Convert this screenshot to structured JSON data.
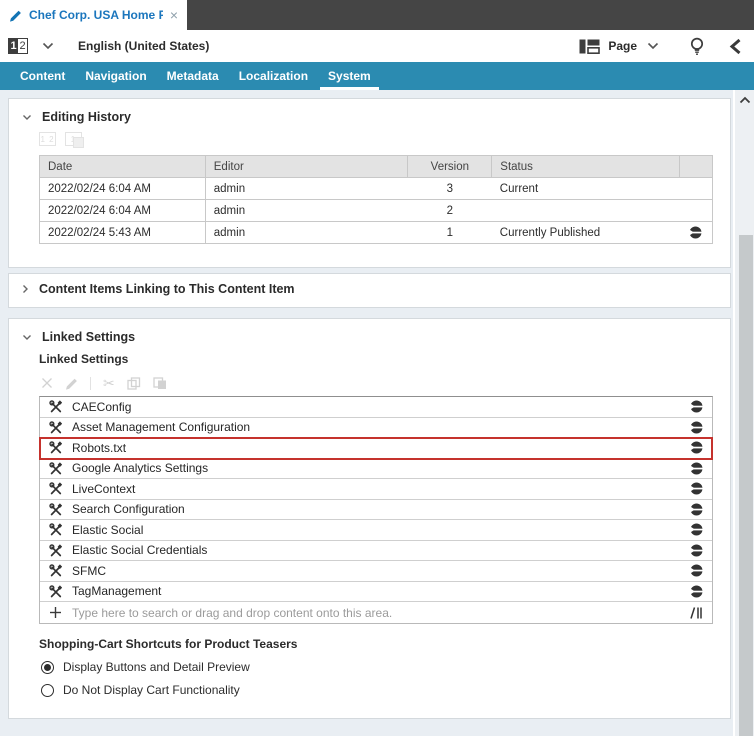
{
  "colors": {
    "nav_teal": "#2b8bb1",
    "highlight_red": "#c5322d",
    "doc_tab_blue": "#1b76bd",
    "topbar_dark": "#454545"
  },
  "doc_tab": {
    "title": "Chef Corp. USA Home P...",
    "close": "×"
  },
  "toolbar": {
    "locale": "English (United States)",
    "view": "Page"
  },
  "nav": {
    "active": "System",
    "tabs": [
      {
        "label": "Content"
      },
      {
        "label": "Navigation"
      },
      {
        "label": "Metadata"
      },
      {
        "label": "Localization"
      },
      {
        "label": "System"
      }
    ]
  },
  "history": {
    "title": "Editing History",
    "table": {
      "headers": {
        "date": "Date",
        "editor": "Editor",
        "version": "Version",
        "status": "Status"
      },
      "rows": [
        {
          "date": "2022/02/24 6:04 AM",
          "editor": "admin",
          "version": "3",
          "status": "Current",
          "published": false
        },
        {
          "date": "2022/02/24 6:04 AM",
          "editor": "admin",
          "version": "2",
          "status": "",
          "published": false
        },
        {
          "date": "2022/02/24 5:43 AM",
          "editor": "admin",
          "version": "1",
          "status": "Currently Published",
          "published": true
        }
      ]
    }
  },
  "linking": {
    "title": "Content Items Linking to This Content Item"
  },
  "linked": {
    "title": "Linked Settings",
    "field_label": "Linked Settings",
    "items": [
      {
        "label": "CAEConfig",
        "highlighted": false
      },
      {
        "label": "Asset Management Configuration",
        "highlighted": false
      },
      {
        "label": "Robots.txt",
        "highlighted": true
      },
      {
        "label": "Google Analytics Settings",
        "highlighted": false
      },
      {
        "label": "LiveContext",
        "highlighted": false
      },
      {
        "label": "Search Configuration",
        "highlighted": false
      },
      {
        "label": "Elastic Social",
        "highlighted": false
      },
      {
        "label": "Elastic Social Credentials",
        "highlighted": false
      },
      {
        "label": "SFMC",
        "highlighted": false
      },
      {
        "label": "TagManagement",
        "highlighted": false
      }
    ],
    "search_placeholder": "Type here to search or drag and drop content onto this area.",
    "shortcuts": {
      "title": "Shopping-Cart Shortcuts for Product Teasers",
      "options": [
        {
          "label": "Display Buttons and Detail Preview",
          "selected": true
        },
        {
          "label": "Do Not Display Cart Functionality",
          "selected": false
        }
      ]
    }
  }
}
